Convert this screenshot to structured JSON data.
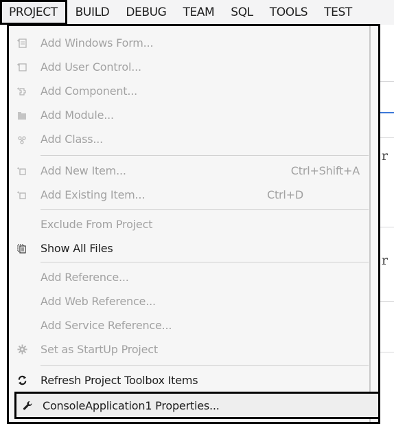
{
  "menubar": {
    "items": [
      "PROJECT",
      "BUILD",
      "DEBUG",
      "TEAM",
      "SQL",
      "TOOLS",
      "TEST"
    ]
  },
  "menu": {
    "add_windows_form": "Add Windows Form...",
    "add_user_control": "Add User Control...",
    "add_component": "Add Component...",
    "add_module": "Add Module...",
    "add_class": "Add Class...",
    "add_new_item": "Add New Item...",
    "add_new_item_shortcut": "Ctrl+Shift+A",
    "add_existing_item": "Add Existing Item...",
    "add_existing_item_shortcut": "Ctrl+D",
    "exclude_from_project": "Exclude From Project",
    "show_all_files": "Show All Files",
    "add_reference": "Add Reference...",
    "add_web_reference": "Add Web Reference...",
    "add_service_reference": "Add Service Reference...",
    "set_as_startup": "Set as StartUp Project",
    "refresh_toolbox": "Refresh Project Toolbox Items",
    "properties": "ConsoleApplication1 Properties..."
  },
  "background": {
    "glyph": "r"
  }
}
